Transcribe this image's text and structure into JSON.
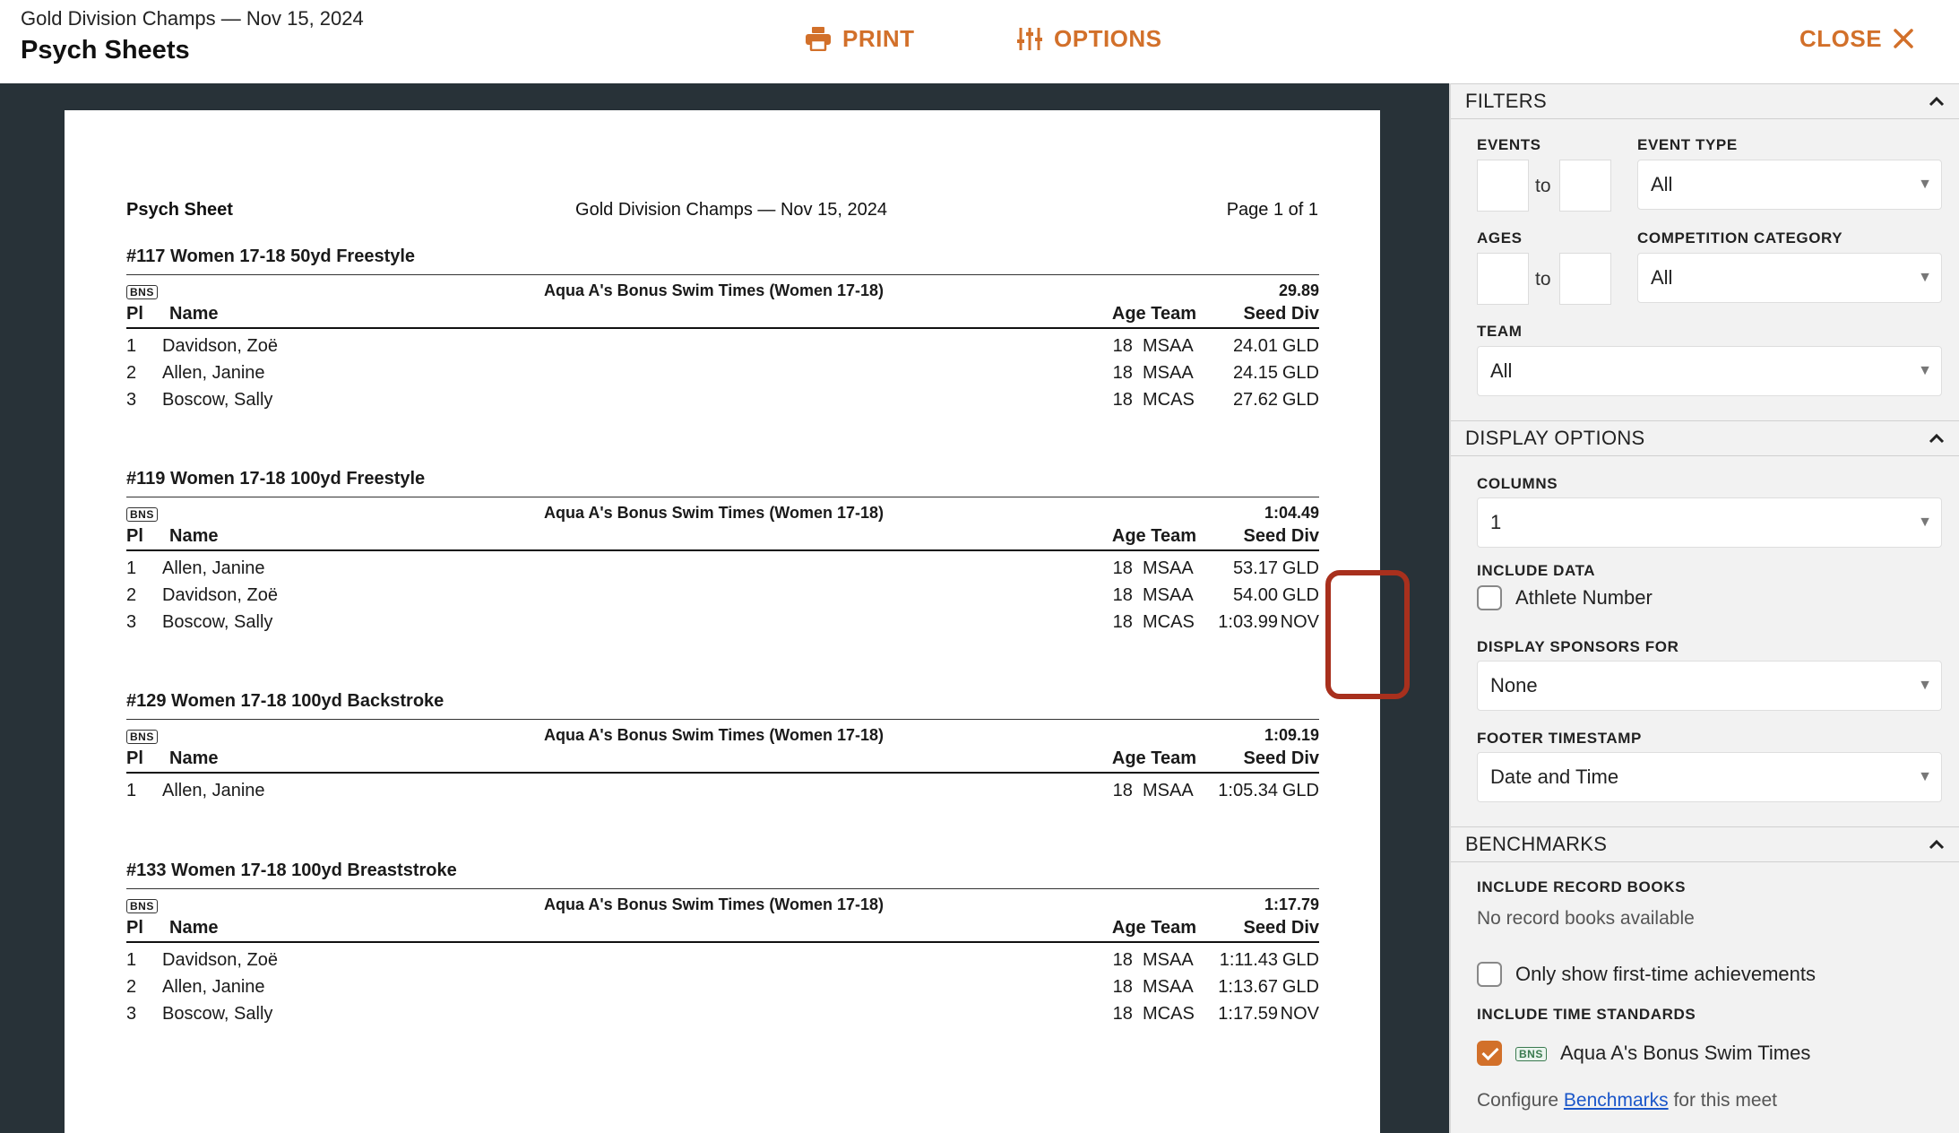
{
  "header": {
    "meet_subtitle": "Gold Division Champs — Nov 15, 2024",
    "title": "Psych Sheets",
    "print_label": "PRINT",
    "options_label": "OPTIONS",
    "close_label": "CLOSE"
  },
  "sheet": {
    "title": "Psych Sheet",
    "meet": "Gold Division Champs — Nov 15, 2024",
    "page": "Page 1 of 1",
    "columns": {
      "pl": "Pl",
      "name": "Name",
      "age_team": "Age Team",
      "seed_div": "Seed Div"
    },
    "events": [
      {
        "title": "#117 Women 17-18 50yd Freestyle",
        "badge": "BNS",
        "standard_name": "Aqua A's Bonus Swim Times (Women 17-18)",
        "standard_time": "29.89",
        "rows": [
          {
            "pl": "1",
            "name": "Davidson, Zoë",
            "age": "18",
            "team": "MSAA",
            "seed": "24.01",
            "div": "GLD"
          },
          {
            "pl": "2",
            "name": "Allen, Janine",
            "age": "18",
            "team": "MSAA",
            "seed": "24.15",
            "div": "GLD"
          },
          {
            "pl": "3",
            "name": "Boscow, Sally",
            "age": "18",
            "team": "MCAS",
            "seed": "27.62",
            "div": "GLD"
          }
        ]
      },
      {
        "title": "#119 Women 17-18 100yd Freestyle",
        "badge": "BNS",
        "standard_name": "Aqua A's Bonus Swim Times (Women 17-18)",
        "standard_time": "1:04.49",
        "rows": [
          {
            "pl": "1",
            "name": "Allen, Janine",
            "age": "18",
            "team": "MSAA",
            "seed": "53.17",
            "div": "GLD"
          },
          {
            "pl": "2",
            "name": "Davidson, Zoë",
            "age": "18",
            "team": "MSAA",
            "seed": "54.00",
            "div": "GLD"
          },
          {
            "pl": "3",
            "name": "Boscow, Sally",
            "age": "18",
            "team": "MCAS",
            "seed": "1:03.99",
            "div": "NOV"
          }
        ]
      },
      {
        "title": "#129 Women 17-18 100yd Backstroke",
        "badge": "BNS",
        "standard_name": "Aqua A's Bonus Swim Times (Women 17-18)",
        "standard_time": "1:09.19",
        "rows": [
          {
            "pl": "1",
            "name": "Allen, Janine",
            "age": "18",
            "team": "MSAA",
            "seed": "1:05.34",
            "div": "GLD"
          }
        ]
      },
      {
        "title": "#133 Women 17-18 100yd Breaststroke",
        "badge": "BNS",
        "standard_name": "Aqua A's Bonus Swim Times (Women 17-18)",
        "standard_time": "1:17.79",
        "rows": [
          {
            "pl": "1",
            "name": "Davidson, Zoë",
            "age": "18",
            "team": "MSAA",
            "seed": "1:11.43",
            "div": "GLD"
          },
          {
            "pl": "2",
            "name": "Allen, Janine",
            "age": "18",
            "team": "MSAA",
            "seed": "1:13.67",
            "div": "GLD"
          },
          {
            "pl": "3",
            "name": "Boscow, Sally",
            "age": "18",
            "team": "MCAS",
            "seed": "1:17.59",
            "div": "NOV"
          }
        ]
      }
    ]
  },
  "filters": {
    "heading": "FILTERS",
    "events_label": "EVENTS",
    "events_from": "",
    "events_to": "",
    "to_label": "to",
    "event_type_label": "EVENT TYPE",
    "event_type_value": "All",
    "ages_label": "AGES",
    "ages_from": "",
    "ages_to": "",
    "competition_category_label": "COMPETITION CATEGORY",
    "competition_category_value": "All",
    "team_label": "TEAM",
    "team_value": "All"
  },
  "display_options": {
    "heading": "DISPLAY OPTIONS",
    "columns_label": "COLUMNS",
    "columns_value": "1",
    "include_data_label": "INCLUDE DATA",
    "athlete_number_label": "Athlete Number",
    "athlete_number_checked": false,
    "display_sponsors_label": "DISPLAY SPONSORS FOR",
    "display_sponsors_value": "None",
    "footer_timestamp_label": "FOOTER TIMESTAMP",
    "footer_timestamp_value": "Date and Time"
  },
  "benchmarks": {
    "heading": "BENCHMARKS",
    "record_books_label": "INCLUDE RECORD BOOKS",
    "record_books_text": "No record books available",
    "first_time_label": "Only show first-time achievements",
    "first_time_checked": false,
    "time_standards_label": "INCLUDE TIME STANDARDS",
    "standard_badge": "BNS",
    "standard_label": "Aqua A's Bonus Swim Times",
    "standard_checked": true,
    "configure_prefix": "Configure",
    "configure_link": "Benchmarks",
    "configure_suffix": "for this meet"
  },
  "colors": {
    "accent": "#d2702a",
    "preview_bg": "#283238",
    "highlight": "#a8301d",
    "link": "#1a56c9"
  },
  "icons": {
    "print": "printer-icon",
    "options": "sliders-icon",
    "close": "close-icon",
    "collapse": "chevron-up-icon",
    "dropdown": "caret-down-icon"
  }
}
